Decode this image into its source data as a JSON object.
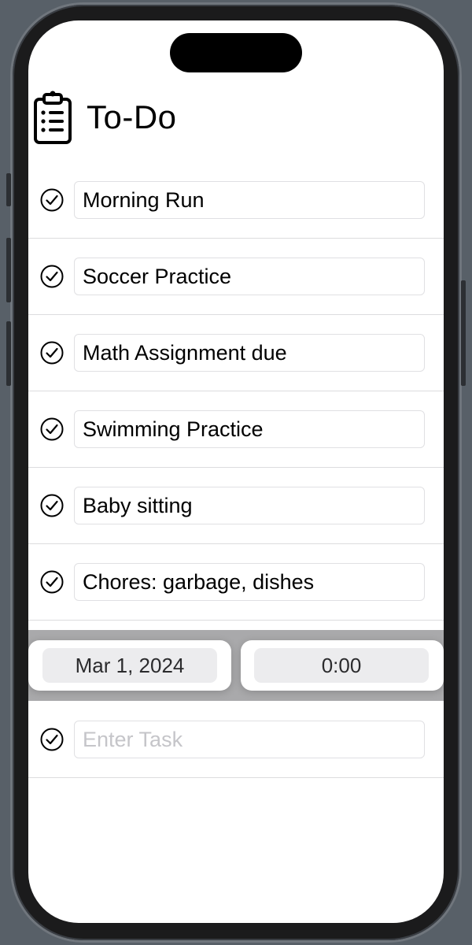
{
  "app": {
    "title": "To-Do",
    "title_icon": "clipboard-list-icon"
  },
  "tasks": [
    {
      "text": "Morning Run",
      "icon": "checkmark-circle-icon"
    },
    {
      "text": "Soccer Practice",
      "icon": "checkmark-circle-icon"
    },
    {
      "text": "Math Assignment due",
      "icon": "checkmark-circle-icon"
    },
    {
      "text": "Swimming Practice",
      "icon": "checkmark-circle-icon"
    },
    {
      "text": "Baby sitting",
      "icon": "checkmark-circle-icon"
    },
    {
      "text": "Chores: garbage, dishes",
      "icon": "checkmark-circle-icon"
    }
  ],
  "picker": {
    "date": "Mar 1, 2024",
    "time": "0:00"
  },
  "new_task": {
    "value": "",
    "placeholder": "Enter Task",
    "icon": "checkmark-circle-icon"
  },
  "colors": {
    "background": "#586068",
    "screen": "#ffffff",
    "picker_band": "#a9a9ab",
    "placeholder": "#c5c5c9"
  }
}
